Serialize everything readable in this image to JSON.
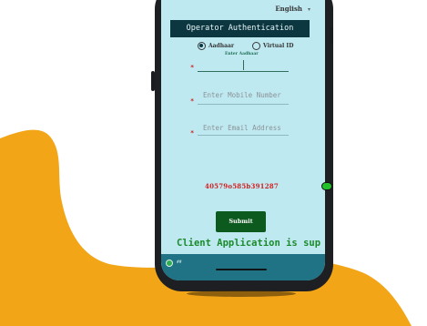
{
  "colors": {
    "background_blob": "#f2a516",
    "screen_bg": "#bfe9f1",
    "title_bar": "#0c3741",
    "submit": "#0d5a1e",
    "device_code": "#d21f1f",
    "marquee": "#1b8a2b",
    "footer": "#1f7384"
  },
  "header": {
    "language": "English",
    "language_caret": "▾"
  },
  "app": {
    "title": "Operator Authentication"
  },
  "auth_type": {
    "options": [
      {
        "label": "Aadhaar",
        "selected": true
      },
      {
        "label": "Virtual ID",
        "selected": false
      }
    ]
  },
  "form": {
    "aadhaar_label": "Enter Aadhaar",
    "required_mark": "*",
    "mobile_placeholder": "Enter Mobile Number",
    "email_placeholder": "Enter Email Address"
  },
  "device": {
    "code": "40579o585b391287"
  },
  "actions": {
    "submit_label": "Submit"
  },
  "marquee": {
    "text": "Client Application is sup"
  },
  "footer": {
    "logo_icon": "app-logo-icon",
    "version": "##"
  }
}
